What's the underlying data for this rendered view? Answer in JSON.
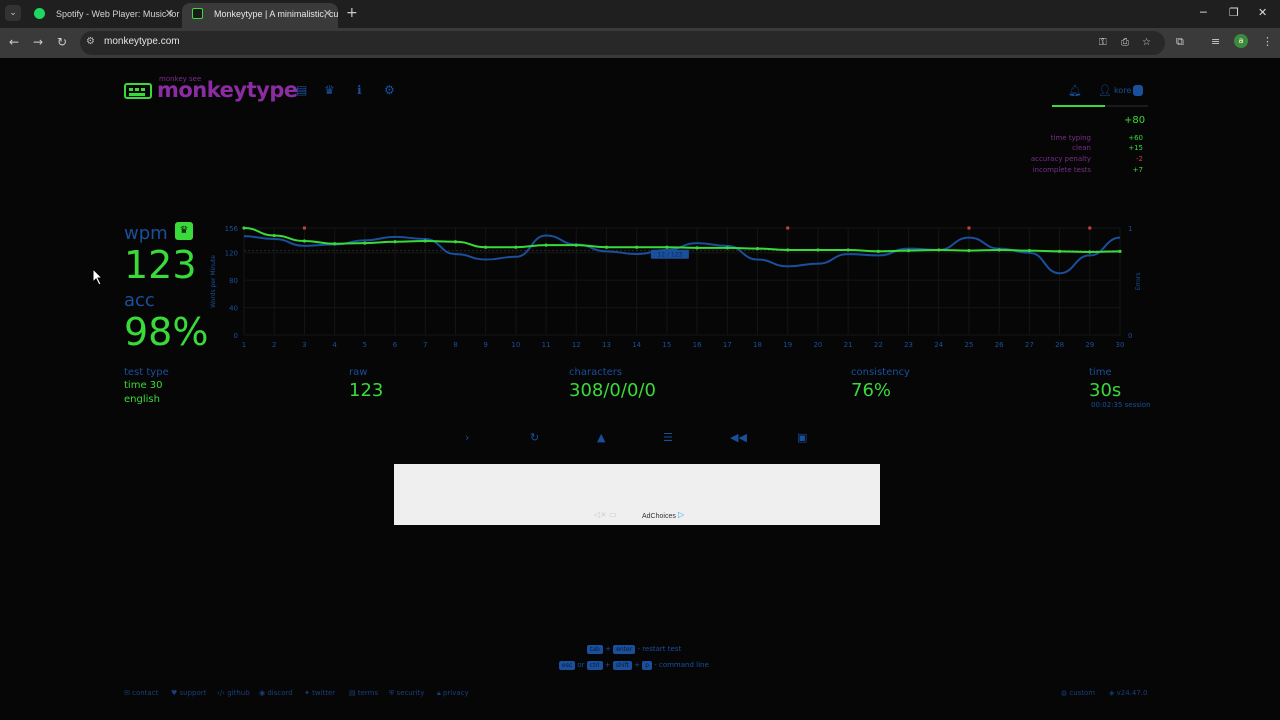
{
  "browser": {
    "tabs": [
      {
        "title": "Spotify - Web Player: Music for",
        "favicon_color": "#1ed760",
        "active": false
      },
      {
        "title": "Monkeytype | A minimalistic, cu",
        "favicon_color": "#3ada3a",
        "active": true
      }
    ],
    "url": "monkeytype.com",
    "profile_initial": "a"
  },
  "header": {
    "logo_small": "monkey see",
    "logo": "monkeytype",
    "username": "kore",
    "xp_progress": 0.55
  },
  "xp": {
    "gain": "+80",
    "breakdown": [
      {
        "label": "time typing",
        "value": "+60"
      },
      {
        "label": "clean",
        "value": "+15"
      },
      {
        "label": "accuracy penalty",
        "value": "-2"
      },
      {
        "label": "incomplete tests",
        "value": "+7"
      }
    ]
  },
  "results": {
    "wpm_label": "wpm",
    "wpm": "123",
    "acc_label": "acc",
    "acc": "98%",
    "test_type_label": "test type",
    "test_type_mode": "time 30",
    "test_type_lang": "english",
    "raw_label": "raw",
    "raw": "123",
    "characters_label": "characters",
    "characters": "308/0/0/0",
    "consistency_label": "consistency",
    "consistency": "76%",
    "time_label": "time",
    "time": "30s",
    "session": "00:02:35 session"
  },
  "chart_data": {
    "type": "line",
    "ylabel": "Words per Minute",
    "y2label": "Errors",
    "ylim": [
      0,
      156
    ],
    "yticks": [
      0,
      40,
      80,
      120,
      156
    ],
    "y2ticks": [
      0,
      1
    ],
    "x": [
      1,
      2,
      3,
      4,
      5,
      6,
      7,
      8,
      9,
      10,
      11,
      12,
      13,
      14,
      15,
      16,
      17,
      18,
      19,
      20,
      21,
      22,
      23,
      24,
      25,
      26,
      27,
      28,
      29,
      30
    ],
    "series": [
      {
        "name": "wpm",
        "color": "#3ada3a",
        "values": [
          156,
          145,
          137,
          133,
          134,
          136,
          137,
          136,
          128,
          128,
          131,
          131,
          128,
          128,
          128,
          127,
          127,
          126,
          124,
          124,
          124,
          122,
          123,
          124,
          123,
          124,
          123,
          122,
          121,
          122
        ]
      },
      {
        "name": "raw",
        "color": "#1a4f9c",
        "values": [
          144,
          140,
          130,
          132,
          138,
          143,
          140,
          118,
          110,
          114,
          145,
          132,
          122,
          118,
          124,
          134,
          130,
          110,
          100,
          104,
          118,
          116,
          126,
          124,
          142,
          126,
          120,
          90,
          116,
          142
        ]
      },
      {
        "name": "errors",
        "color": "#c9413b",
        "values": [
          0,
          0,
          1,
          0,
          0,
          0,
          0,
          0,
          0,
          0,
          0,
          0,
          0,
          0,
          0,
          0,
          0,
          0,
          1,
          0,
          0,
          0,
          0,
          0,
          1,
          0,
          0,
          0,
          1,
          0
        ]
      }
    ],
    "tooltip": "12 / 123",
    "grid": true
  },
  "actions": [
    "next-test",
    "restart",
    "report",
    "words-history",
    "replay",
    "screenshot"
  ],
  "hints": {
    "line1": [
      "tab",
      "+",
      "enter",
      "- restart test"
    ],
    "line2": [
      "esc",
      "or",
      "ctrl",
      "shift",
      "p",
      "- command line"
    ]
  },
  "footer": {
    "links": [
      "contact",
      "support",
      "github",
      "discord",
      "twitter",
      "terms",
      "security",
      "privacy"
    ],
    "theme": "custom",
    "version": "v24.47.0"
  },
  "ad": {
    "choices": "AdChoices"
  }
}
